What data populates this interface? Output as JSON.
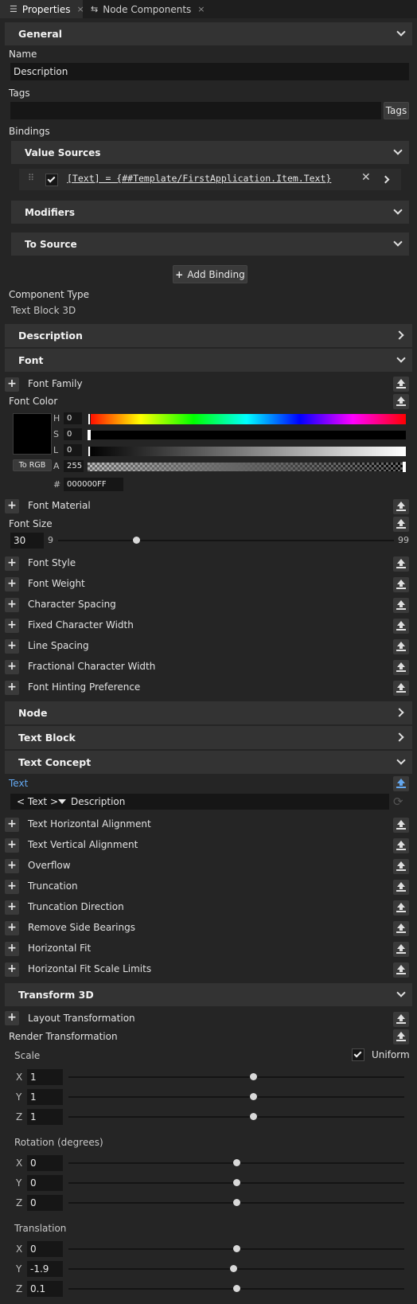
{
  "tabs": [
    {
      "label": "Properties",
      "icon": "list-icon",
      "close": "×"
    },
    {
      "label": "Node Components",
      "icon": "components-icon",
      "close": "×"
    }
  ],
  "general": {
    "title": "General",
    "name_label": "Name",
    "name_value": "Description",
    "tags_label": "Tags",
    "tags_value": "",
    "tags_button": "Tags",
    "bindings_label": "Bindings",
    "value_sources_title": "Value Sources",
    "binding_expression": "[Text] = {##Template/FirstApplication.Item.Text}",
    "modifiers_title": "Modifiers",
    "to_source_title": "To Source",
    "add_binding": "Add Binding",
    "add_binding_plus": "+",
    "component_type_label": "Component Type",
    "component_type_value": "Text Block 3D"
  },
  "sections": {
    "description": "Description",
    "font": "Font",
    "node": "Node",
    "text_block": "Text Block",
    "text_concept": "Text Concept",
    "transform": "Transform 3D"
  },
  "font": {
    "font_family": "Font Family",
    "font_color": "Font Color",
    "color_hex": "000000FF",
    "color_swatch": "#000000",
    "channels": [
      {
        "label": "H",
        "value": "0",
        "level": 0
      },
      {
        "label": "S",
        "value": "0",
        "level": 0
      },
      {
        "label": "L",
        "value": "0",
        "level": 0
      },
      {
        "label": "A",
        "value": "255",
        "level": 1
      }
    ],
    "to_rgb": "To RGB",
    "hash": "#",
    "font_material": "Font Material",
    "font_size_label": "Font Size",
    "font_size_value": "30",
    "font_size_min": "9",
    "font_size_max": "99",
    "props": [
      "Font Style",
      "Font Weight",
      "Character Spacing",
      "Fixed Character Width",
      "Line Spacing",
      "Fractional Character Width",
      "Font Hinting Preference"
    ]
  },
  "text_concept": {
    "text_label": "Text",
    "text_type": "< Text >",
    "text_value": "Description",
    "props": [
      "Text Horizontal Alignment",
      "Text Vertical Alignment",
      "Overflow",
      "Truncation",
      "Truncation Direction",
      "Remove Side Bearings",
      "Horizontal Fit",
      "Horizontal Fit Scale Limits"
    ]
  },
  "transform": {
    "layout_transformation": "Layout Transformation",
    "render_transformation": "Render Transformation",
    "scale_label": "Scale",
    "uniform_label": "Uniform",
    "rotation_label": "Rotation (degrees)",
    "translation_label": "Translation",
    "scale": [
      {
        "axis": "X",
        "value": "1",
        "level": 0.55
      },
      {
        "axis": "Y",
        "value": "1",
        "level": 0.55
      },
      {
        "axis": "Z",
        "value": "1",
        "level": 0.55
      }
    ],
    "rotation": [
      {
        "axis": "X",
        "value": "0",
        "level": 0.5
      },
      {
        "axis": "Y",
        "value": "0",
        "level": 0.5
      },
      {
        "axis": "Z",
        "value": "0",
        "level": 0.5
      }
    ],
    "translation": [
      {
        "axis": "X",
        "value": "0",
        "level": 0.5
      },
      {
        "axis": "Y",
        "value": "-1.9",
        "level": 0.49
      },
      {
        "axis": "Z",
        "value": "0.1",
        "level": 0.5
      }
    ]
  },
  "colors": {
    "panel": "#252525",
    "header": "#333333",
    "input": "#161616",
    "accent": "#64a8f0"
  }
}
